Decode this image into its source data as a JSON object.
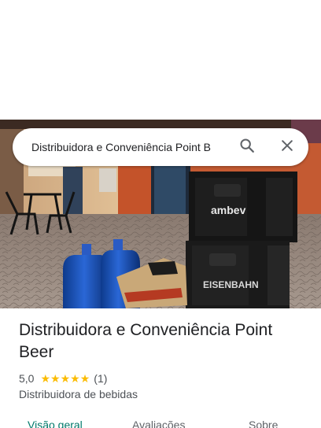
{
  "search": {
    "query": "Distribuidora e Conveniência Point B",
    "search_icon": "search-icon",
    "close_icon": "close-icon"
  },
  "hero": {
    "crate_brand_1": "ambev",
    "crate_brand_2": "EISENBAHN"
  },
  "place": {
    "title": "Distribuidora e Conveniência Point Beer",
    "rating": "5,0",
    "stars_filled": 5,
    "review_count": "(1)",
    "category": "Distribuidora de bebidas"
  },
  "tabs": [
    {
      "label": "Visão geral",
      "active": true
    },
    {
      "label": "Avaliações",
      "active": false
    },
    {
      "label": "Sobre",
      "active": false
    }
  ],
  "colors": {
    "accent_tab": "#00796b",
    "star": "#fbbc04",
    "text_primary": "#202124",
    "text_secondary": "#4d5156"
  }
}
